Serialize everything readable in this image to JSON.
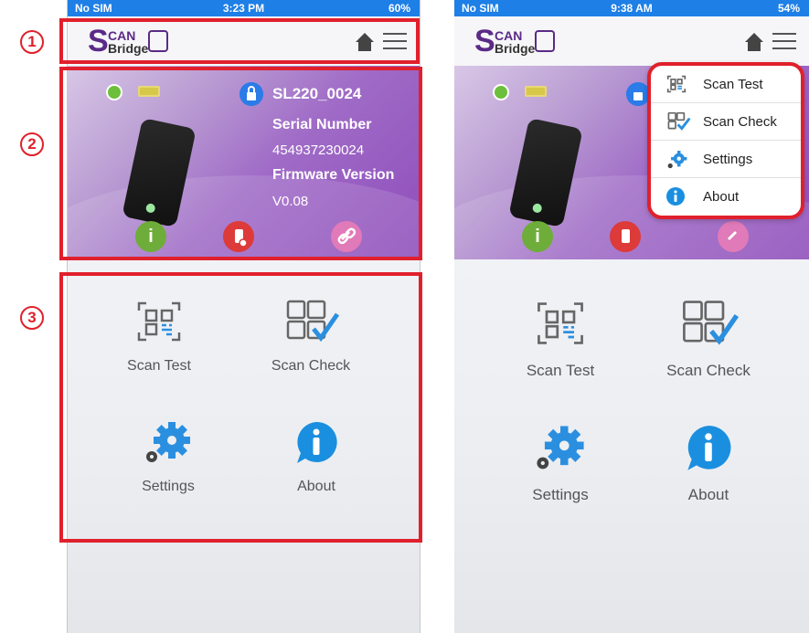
{
  "left_screen": {
    "status": {
      "carrier": "No SIM",
      "time": "3:23 PM",
      "battery": "60%"
    },
    "device": {
      "name": "SL220_0024",
      "serial_label": "Serial Number",
      "serial_value": "454937230024",
      "firmware_label": "Firmware Version",
      "firmware_value": "V0.08"
    },
    "tiles": [
      {
        "label": "Scan Test",
        "icon": "qr-scan-icon"
      },
      {
        "label": "Scan Check",
        "icon": "qr-check-icon"
      },
      {
        "label": "Settings",
        "icon": "gear-icon"
      },
      {
        "label": "About",
        "icon": "info-bubble-icon"
      }
    ],
    "annotations": [
      "1",
      "2",
      "3"
    ]
  },
  "right_screen": {
    "status": {
      "carrier": "No SIM",
      "time": "9:38 AM",
      "battery": "54%"
    },
    "menu": [
      {
        "label": "Scan Test",
        "icon": "qr-scan-icon"
      },
      {
        "label": "Scan Check",
        "icon": "qr-check-icon"
      },
      {
        "label": "Settings",
        "icon": "gear-icon"
      },
      {
        "label": "About",
        "icon": "info-icon"
      }
    ],
    "tiles": [
      {
        "label": "Scan Test"
      },
      {
        "label": "Scan Check"
      },
      {
        "label": "Settings"
      },
      {
        "label": "About"
      }
    ]
  },
  "colors": {
    "accent": "#1e7fe6",
    "brand": "#5b2a86",
    "highlight": "#e0202c",
    "info_green": "#6fad3a"
  }
}
